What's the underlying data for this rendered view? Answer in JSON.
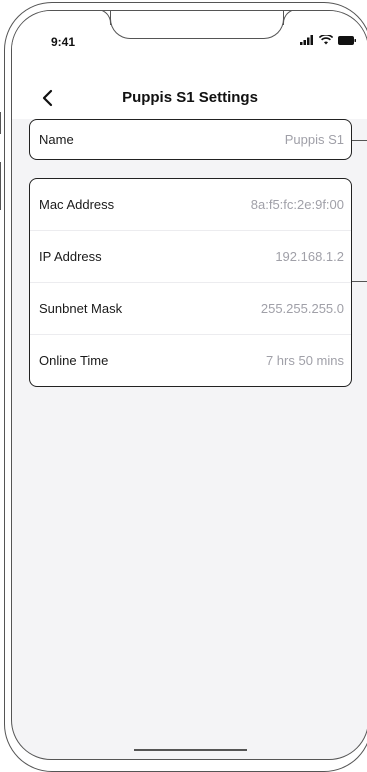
{
  "status_bar": {
    "time": "9:41"
  },
  "header": {
    "title": "Puppis S1 Settings"
  },
  "name_card": {
    "label": "Name",
    "value": "Puppis S1"
  },
  "info_card": {
    "rows": [
      {
        "label": "Mac Address",
        "value": "8a:f5:fc:2e:9f:00"
      },
      {
        "label": "IP Address",
        "value": "192.168.1.2"
      },
      {
        "label": "Sunbnet Mask",
        "value": "255.255.255.0"
      },
      {
        "label": "Online Time",
        "value": "7 hrs 50 mins"
      }
    ]
  },
  "colors": {
    "label_text": "#1a1a1a",
    "value_text": "#a0a0a8",
    "background": "#f4f4f6"
  }
}
